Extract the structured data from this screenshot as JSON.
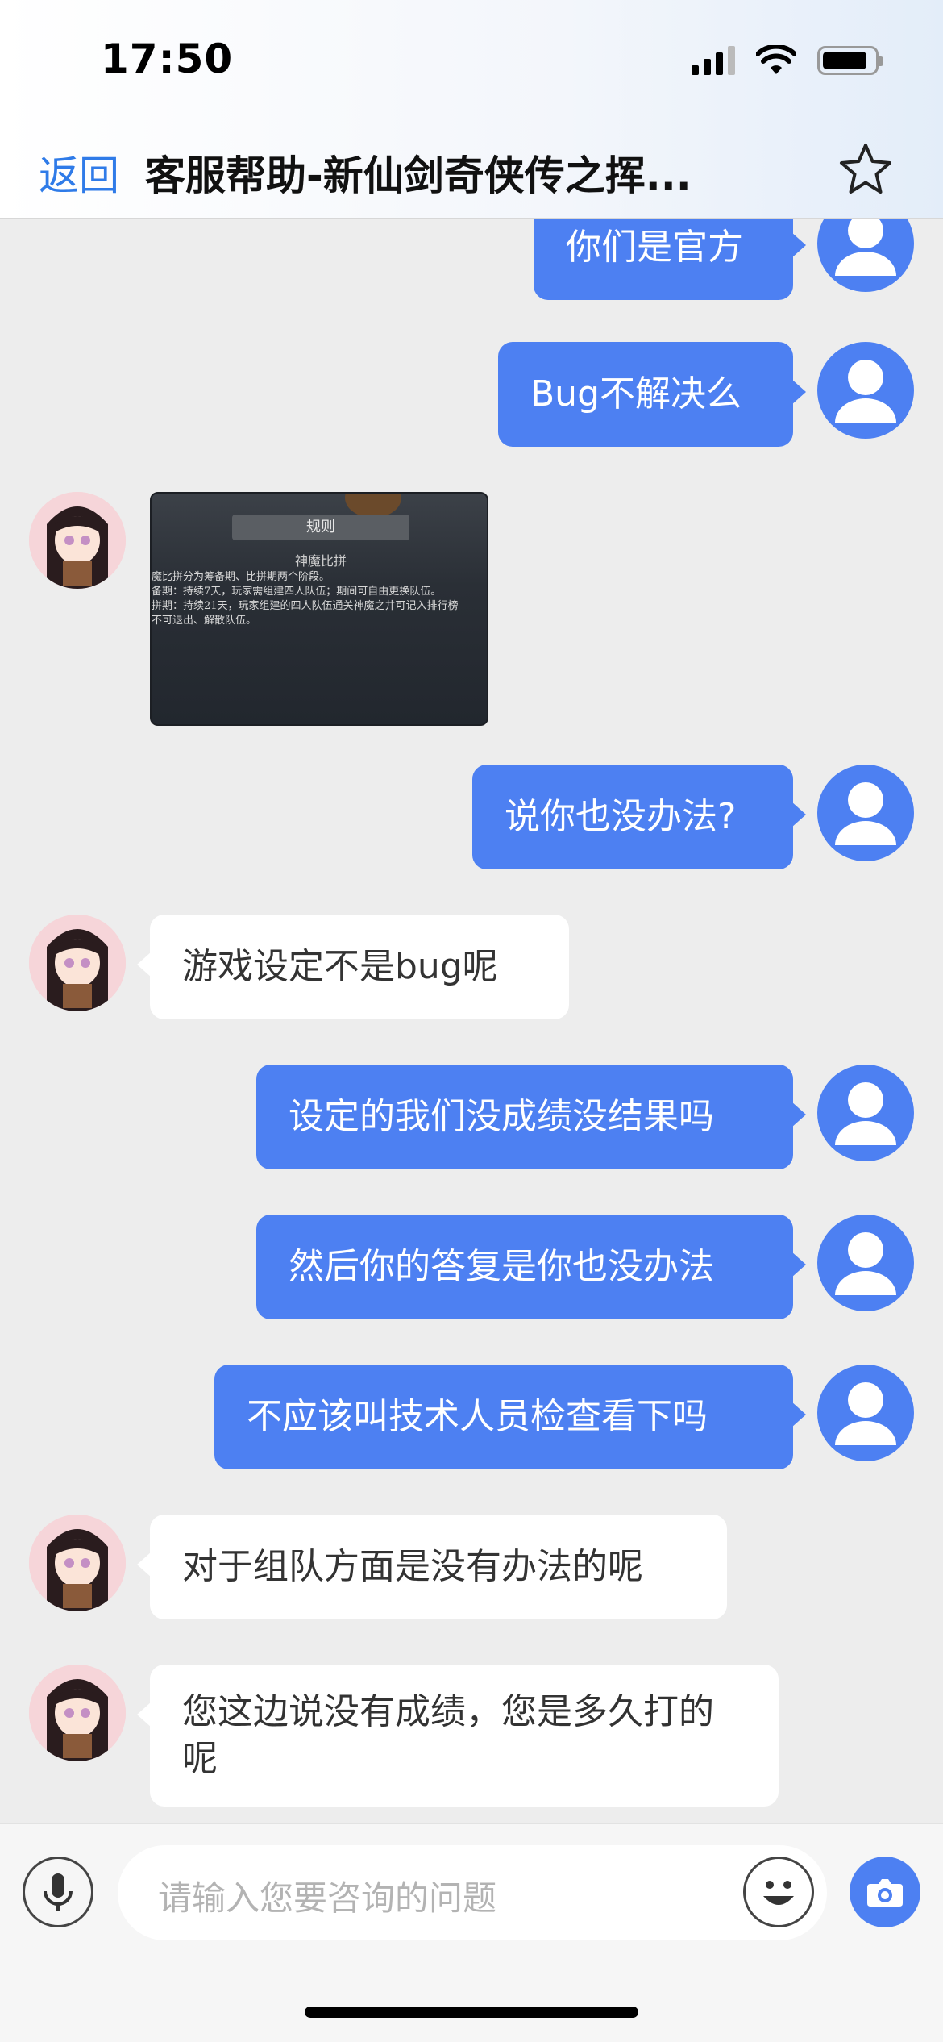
{
  "status_bar": {
    "time": "17:50"
  },
  "nav": {
    "back_label": "返回",
    "title": "客服帮助-新仙剑奇侠传之挥..."
  },
  "messages": [
    {
      "from": "user",
      "text": "你们是官方"
    },
    {
      "from": "user",
      "text": "Bug不解决么"
    },
    {
      "from": "agent",
      "type": "image",
      "image_text": {
        "banner": "规则",
        "subtitle": "神魔比拼",
        "lines": [
          "魔比拼分为筹备期、比拼期两个阶段。",
          "备期：持续7天，玩家需组建四人队伍；期间可自由更换队伍。",
          "拼期：持续21天，玩家组建的四人队伍通关神魔之井可记入排行榜",
          "不可退出、解散队伍。"
        ]
      }
    },
    {
      "from": "user",
      "text": "说你也没办法?"
    },
    {
      "from": "agent",
      "text": "游戏设定不是bug呢"
    },
    {
      "from": "user",
      "text": "设定的我们没成绩没结果吗"
    },
    {
      "from": "user",
      "text": "然后你的答复是你也没办法"
    },
    {
      "from": "user",
      "text": "不应该叫技术人员检查看下吗"
    },
    {
      "from": "agent",
      "text": "对于组队方面是没有办法的呢"
    },
    {
      "from": "agent",
      "text": "您这边说没有成绩，您是多久打的呢"
    }
  ],
  "input": {
    "placeholder": "请输入您要咨询的问题"
  },
  "colors": {
    "accent": "#4d80f2",
    "link": "#2f7be8",
    "background": "#ededed"
  }
}
